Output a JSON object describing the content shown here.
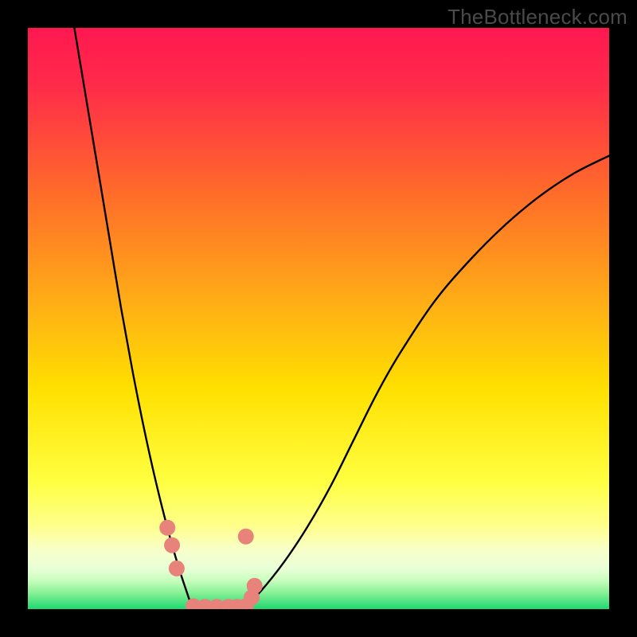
{
  "watermark": "TheBottleneck.com",
  "chart_data": {
    "type": "line",
    "title": "",
    "xlabel": "",
    "ylabel": "",
    "xlim": [
      0,
      100
    ],
    "ylim": [
      0,
      100
    ],
    "background_gradient": {
      "top": "#ff1a4d",
      "mid1": "#ff6a2a",
      "mid2": "#ffd400",
      "mid3": "#ffff66",
      "mid4": "#f5ffb3",
      "bottom": "#20e070"
    },
    "series": [
      {
        "name": "left-curve",
        "x": [
          8,
          10,
          12,
          14,
          16,
          18,
          20,
          22,
          24,
          26,
          28
        ],
        "y": [
          100,
          88,
          76,
          64,
          52,
          41,
          31,
          22,
          14,
          7,
          1
        ]
      },
      {
        "name": "right-curve",
        "x": [
          37,
          40,
          44,
          48,
          52,
          56,
          60,
          64,
          70,
          76,
          82,
          88,
          94,
          100
        ],
        "y": [
          0,
          3,
          8,
          14,
          21,
          29,
          37,
          44,
          53,
          60,
          66,
          71,
          75,
          78
        ]
      }
    ],
    "markers": {
      "name": "dots",
      "color": "#e8837b",
      "points": [
        {
          "x": 24.0,
          "y": 14
        },
        {
          "x": 24.8,
          "y": 11
        },
        {
          "x": 25.6,
          "y": 7
        },
        {
          "x": 28.5,
          "y": 0.5
        },
        {
          "x": 30.5,
          "y": 0.4
        },
        {
          "x": 32.5,
          "y": 0.4
        },
        {
          "x": 34.5,
          "y": 0.4
        },
        {
          "x": 36.0,
          "y": 0.4
        },
        {
          "x": 37.5,
          "y": 0.5
        },
        {
          "x": 38.5,
          "y": 2.0
        },
        {
          "x": 39.0,
          "y": 4.0
        },
        {
          "x": 37.5,
          "y": 12.5
        }
      ]
    }
  }
}
